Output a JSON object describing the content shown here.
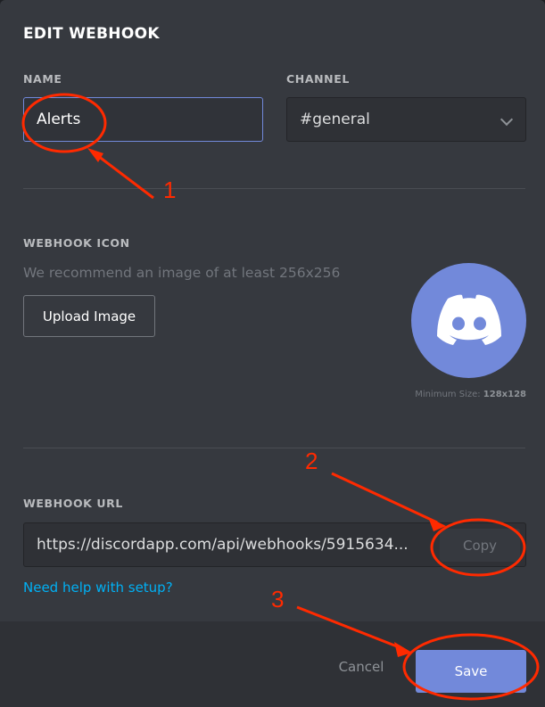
{
  "dialog": {
    "title": "EDIT WEBHOOK",
    "name_label": "NAME",
    "name_value": "Alerts",
    "channel_label": "CHANNEL",
    "channel_value": "#general",
    "icon_label": "WEBHOOK ICON",
    "icon_hint": "We recommend an image of at least 256x256",
    "upload_button": "Upload Image",
    "avatar_icon": "discord-logo-icon",
    "min_size_label": "Minimum Size: ",
    "min_size_value": "128x128",
    "url_label": "WEBHOOK URL",
    "url_value": "https://discordapp.com/api/webhooks/5915634...",
    "copy_button": "Copy",
    "help_link": "Need help with setup?",
    "cancel_button": "Cancel",
    "save_button": "Save"
  },
  "colors": {
    "accent": "#7289da",
    "link": "#00b0f4",
    "background": "#36393f",
    "annotation": "#ff2a00"
  },
  "annotations": [
    "1",
    "2",
    "3"
  ]
}
